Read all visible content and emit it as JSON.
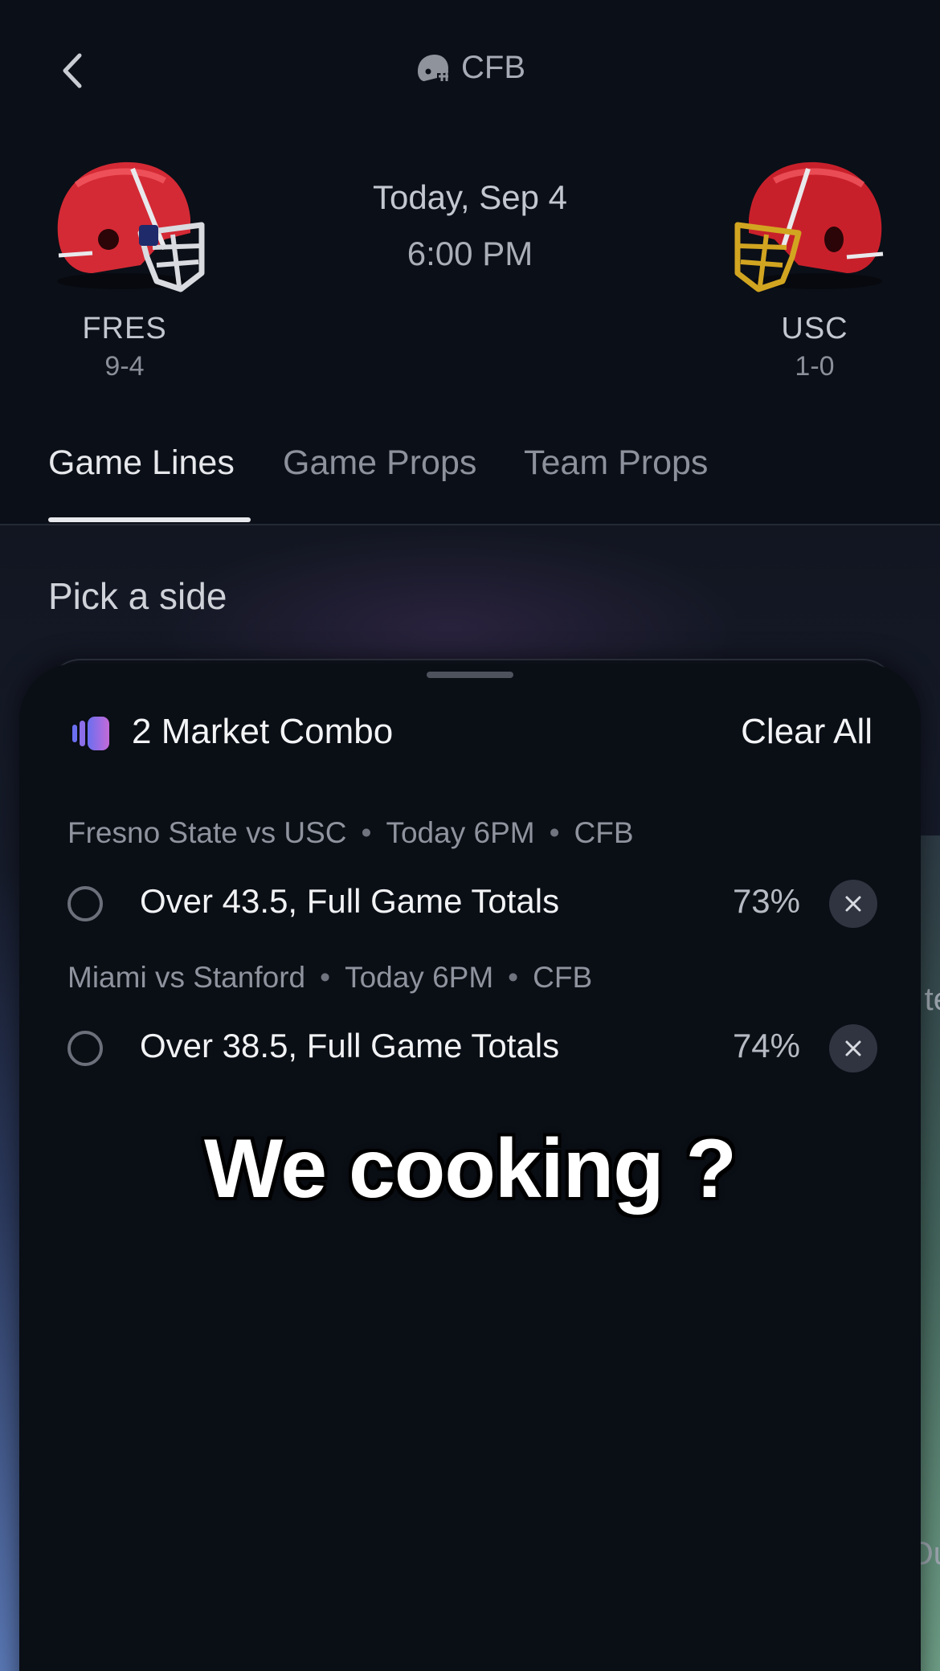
{
  "header": {
    "league": "CFB",
    "league_icon": "football-helmet-icon",
    "back_icon": "chevron-left-icon"
  },
  "matchup": {
    "date": "Today, Sep 4",
    "time": "6:00 PM",
    "home": {
      "abbr": "FRES",
      "record": "9-4",
      "helmet_color": "#d42a35",
      "mask_color": "#d9dbe0"
    },
    "away": {
      "abbr": "USC",
      "record": "1-0",
      "helmet_color": "#c8202b",
      "mask_color": "#d2a521"
    }
  },
  "tabs": [
    {
      "label": "Game Lines",
      "active": true
    },
    {
      "label": "Game Props",
      "active": false
    },
    {
      "label": "Team Props",
      "active": false
    }
  ],
  "section": {
    "title": "Pick a side"
  },
  "combo": {
    "title": "2 Market Combo",
    "clear_label": "Clear All",
    "legs": [
      {
        "matchup": "Fresno State vs USC",
        "time": "Today 6PM",
        "league": "CFB",
        "pick": "Over 43.5, Full Game Totals",
        "percent": "73%"
      },
      {
        "matchup": "Miami vs Stanford",
        "time": "Today 6PM",
        "league": "CFB",
        "pick": "Over 38.5, Full Game Totals",
        "percent": "74%"
      }
    ]
  },
  "caption": "We cooking ?",
  "colors": {
    "background": "#0b0f17",
    "sheet": "#0a0e15",
    "accent_gradient_start": "#6a6ff0",
    "accent_gradient_end": "#c46ad8"
  }
}
